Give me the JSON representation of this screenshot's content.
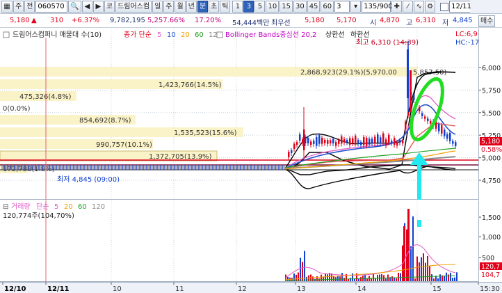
{
  "toolbar": {
    "market": "주",
    "market_alt": "전",
    "code": "060570",
    "market_type": "코",
    "stock_name": "드림어스컴",
    "periods": [
      "일",
      "주",
      "월",
      "년",
      "분",
      "초",
      "틱"
    ],
    "active_period": "분",
    "intervals": [
      "1",
      "3",
      "5",
      "10",
      "15",
      "30",
      "45",
      "60"
    ],
    "active_interval": "3",
    "interval_select": "3",
    "count": "135",
    "count_total": "/900",
    "date": "12/11"
  },
  "quote": {
    "price": "5,180",
    "change": "310",
    "change_pct": "+6.37%",
    "volume": "9,782,195",
    "amount": "5,257.66%",
    "turnover": "17.20%",
    "value": "54,444백만",
    "best_ask_label": "최우선",
    "best_ask": "5,180",
    "best_bid": "5,170",
    "open_label": "시",
    "open": "4,870",
    "high_label": "고",
    "high": "6,310",
    "low_label": "저",
    "low": "4,845",
    "buy_label": "매수"
  },
  "price_legend": {
    "title": "드림어스컴퍼니 매물대 수(10)",
    "ma_label": "종가 단순",
    "ma_periods": [
      "5",
      "10",
      "20",
      "60",
      "120"
    ],
    "bb_label": "Bollinger Bands중심선 20,2",
    "upper_limit": "상한선",
    "lower_limit": "하한선",
    "lc": "LC:6,9",
    "hc": "HC:-17"
  },
  "volume_profile": [
    {
      "label": "2,868,923(29.1%)(5,970,00",
      "row": 0
    },
    {
      "label": "5,857.50)",
      "row": 0
    },
    {
      "label": "1,423,766(14.5%)",
      "row": 1
    },
    {
      "label": "475,326(4.8%)",
      "row": 2
    },
    {
      "label": "0(0.0%)",
      "row": 3
    },
    {
      "label": "854,692(8.7%)",
      "row": 4
    },
    {
      "label": "1,535,523(15.6%)",
      "row": 5
    },
    {
      "label": "990,757(10.1%)",
      "row": 6
    },
    {
      "label": "1,372,705(13.9%)",
      "row": 7
    },
    {
      "label": "172,788(1.8%)",
      "row": 8
    },
    {
      "label": "최저 4,845 (09:00)",
      "row": 9
    }
  ],
  "annotations": {
    "high_marker": "최고 6,310 (14:39)",
    "current_price_tag": "5,180",
    "current_pct_tag": "0.58%"
  },
  "price_axis": [
    "6,000",
    "5,750",
    "5,500",
    "5,250",
    "5,000",
    "4,750"
  ],
  "volume_legend": {
    "title": "거래량",
    "ma_label": "단순",
    "ma_periods": [
      "5",
      "20",
      "60",
      "120"
    ],
    "current": "120,774주(104,70%)"
  },
  "volume_axis": [
    "1,500",
    "1,000",
    "500",
    "120,7",
    "104,7"
  ],
  "date_axis": [
    "12/10",
    "12/11",
    "10",
    "11",
    "12",
    "13",
    "14",
    "15",
    "15:30"
  ],
  "colors": {
    "up": "#e0001a",
    "down": "#1040d0",
    "ma5": "#e05cc8",
    "ma10": "#2050d0",
    "ma20": "#f0a000",
    "ma60": "#20a020",
    "ma120": "#8a8a8a",
    "highlight_ellipse": "#22dd22",
    "highlight_arrow": "#22e8f0"
  },
  "chart_data": {
    "type": "candlestick",
    "ylim": [
      4700,
      6400
    ],
    "ohlc_late": [
      {
        "o": 4870,
        "h": 5000,
        "l": 4845,
        "c": 4980
      },
      {
        "o": 4980,
        "h": 5450,
        "l": 4950,
        "c": 5300
      },
      {
        "o": 5300,
        "h": 5550,
        "l": 5150,
        "c": 5200
      },
      {
        "o": 5200,
        "h": 5300,
        "l": 5100,
        "c": 5150
      },
      {
        "o": 5150,
        "h": 5250,
        "l": 5050,
        "c": 5180
      },
      {
        "o": 5180,
        "h": 5220,
        "l": 5120,
        "c": 5160
      },
      {
        "o": 5160,
        "h": 5200,
        "l": 5130,
        "c": 5170
      },
      {
        "o": 5170,
        "h": 5210,
        "l": 5140,
        "c": 5190
      },
      {
        "o": 5190,
        "h": 5230,
        "l": 5150,
        "c": 5180
      },
      {
        "o": 5180,
        "h": 6100,
        "l": 5170,
        "c": 5900
      },
      {
        "o": 5900,
        "h": 6310,
        "l": 5700,
        "c": 5800
      },
      {
        "o": 5800,
        "h": 5950,
        "l": 5500,
        "c": 5550
      },
      {
        "o": 5550,
        "h": 5650,
        "l": 5300,
        "c": 5400
      },
      {
        "o": 5400,
        "h": 5450,
        "l": 5200,
        "c": 5300
      },
      {
        "o": 5300,
        "h": 5350,
        "l": 5150,
        "c": 5180
      }
    ]
  }
}
